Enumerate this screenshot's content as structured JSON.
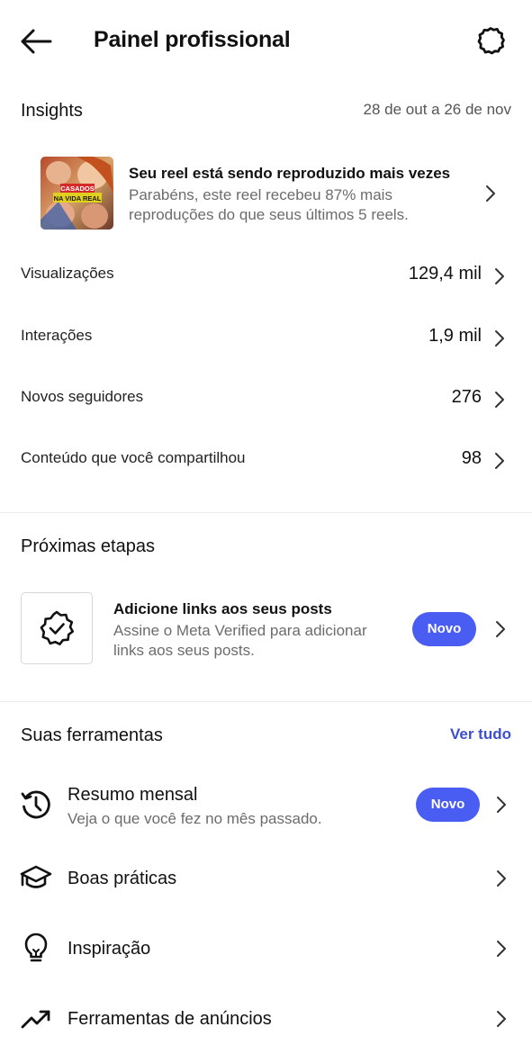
{
  "header": {
    "title": "Painel profissional",
    "back_icon": "arrow-left-icon",
    "settings_icon": "gear-icon"
  },
  "insights": {
    "heading": "Insights",
    "date_range": "28 de out a 26 de nov",
    "reel": {
      "thumbnail_caption_line1": "CASADOS",
      "thumbnail_caption_line2": "NA VIDA REAL",
      "title": "Seu reel está sendo reproduzido mais vezes",
      "description": "Parabéns, este reel recebeu 87% mais reproduções do que seus últimos 5 reels."
    },
    "metrics": [
      {
        "label": "Visualizações",
        "value": "129,4 mil"
      },
      {
        "label": "Interações",
        "value": "1,9 mil"
      },
      {
        "label": "Novos seguidores",
        "value": "276"
      },
      {
        "label": "Conteúdo que você compartilhou",
        "value": "98"
      }
    ]
  },
  "next_steps": {
    "heading": "Próximas etapas",
    "card": {
      "icon": "verified-badge-icon",
      "title": "Adicione links aos seus posts",
      "description": "Assine o Meta Verified para adicionar links aos seus posts.",
      "badge": "Novo"
    }
  },
  "tools": {
    "heading": "Suas ferramentas",
    "see_all": "Ver tudo",
    "items": [
      {
        "icon": "history-clock-icon",
        "label": "Resumo mensal",
        "sub": "Veja o que você fez no mês passado.",
        "badge": "Novo"
      },
      {
        "icon": "graduation-cap-icon",
        "label": "Boas práticas"
      },
      {
        "icon": "lightbulb-icon",
        "label": "Inspiração"
      },
      {
        "icon": "trending-up-icon",
        "label": "Ferramentas de anúncios"
      }
    ]
  },
  "colors": {
    "accent": "#4a5df2",
    "link": "#3d4fcf",
    "secondary_text": "#6c6c6c"
  }
}
